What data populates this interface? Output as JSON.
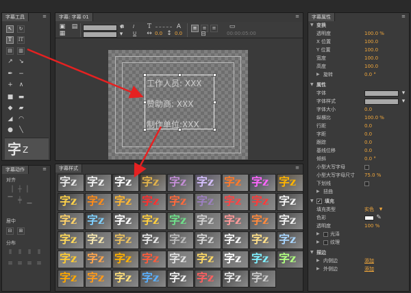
{
  "tools": {
    "title": "字幕工具",
    "preview": {
      "glyph": "字",
      "sub": "Z"
    }
  },
  "actions": {
    "title": "字幕动作",
    "align": "对齐",
    "center": "居中",
    "distribute": "分布"
  },
  "main": {
    "title": "字幕: 字幕 01",
    "menu": "≡",
    "toolbar": {
      "bold": "B",
      "italic": "I",
      "underline": "U",
      "tracking_value": "0.0",
      "leading_value": "0.0",
      "timecode": "00:00:05:00"
    },
    "canvas_lines": [
      "工作人员: XXX",
      "赞助商: XXX",
      "制作单位:XXX"
    ]
  },
  "styles": {
    "title": "字幕样式",
    "glyph": "字",
    "sub": "z"
  },
  "props": {
    "title": "字幕属性",
    "transform_header": "变换",
    "opacity_label": "透明度",
    "opacity_value": "100.0 %",
    "xpos_label": "X 位置",
    "xpos_value": "100.0",
    "ypos_label": "Y 位置",
    "ypos_value": "100.0",
    "width_label": "宽度",
    "width_value": "100.0",
    "height_label": "高度",
    "height_value": "100.0",
    "rotate_label": "旋转",
    "rotate_value": "0.0 °",
    "attrs_header": "属性",
    "font_label": "字体",
    "font_style_label": "字体样式",
    "font_size_label": "字体大小",
    "font_size_value": "0.0",
    "aspect_label": "纵横比",
    "aspect_value": "100.0 %",
    "leading_label": "行距",
    "leading_value": "0.0",
    "kerning_label": "字距",
    "kerning_value": "0.0",
    "tracking_label": "跟踪",
    "tracking_value": "0.0",
    "baseline_label": "基线位移",
    "baseline_value": "0.0",
    "skew_label": "倾斜",
    "skew_value": "0.0 °",
    "smallcaps_label": "小型大写字母",
    "smallcaps_size_label": "小型大写字母尺寸",
    "smallcaps_size_value": "75.0 %",
    "underline_label": "下划线",
    "distort_label": "扭曲",
    "fill_header": "填充",
    "fill_type_label": "填充类型",
    "fill_type_value": "实色",
    "color_label": "色彩",
    "fill_opacity_label": "透明度",
    "fill_opacity_value": "100 %",
    "sheen_label": "光泽",
    "texture_label": "纹理",
    "stroke_header": "描边",
    "inner_label": "内侧边",
    "inner_value": "添加",
    "outer_label": "外侧边",
    "outer_value": "添加"
  },
  "colors": {
    "accent": "#f2a83c",
    "arrow": "#e52121"
  }
}
